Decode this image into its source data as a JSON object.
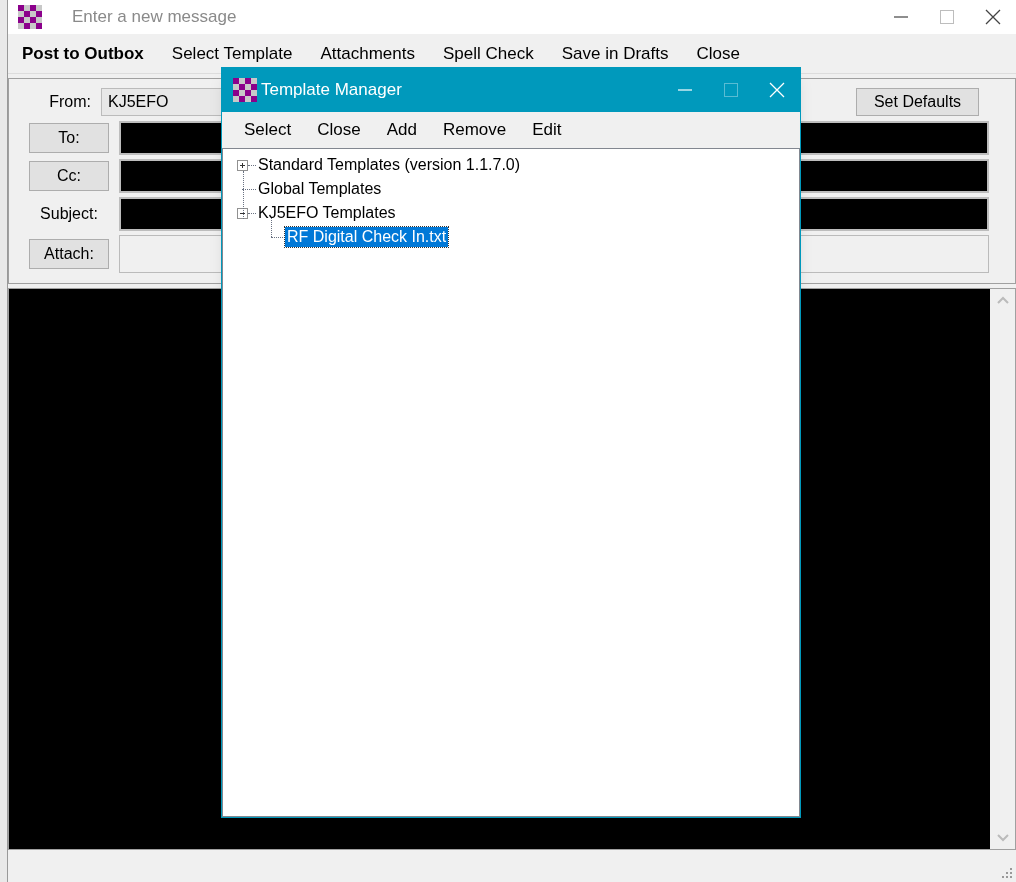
{
  "window": {
    "title": "Enter a new message"
  },
  "menu": [
    {
      "label": "Post to Outbox",
      "primary": true
    },
    {
      "label": "Select Template",
      "primary": false
    },
    {
      "label": "Attachments",
      "primary": false
    },
    {
      "label": "Spell Check",
      "primary": false
    },
    {
      "label": "Save in Drafts",
      "primary": false
    },
    {
      "label": "Close",
      "primary": false
    }
  ],
  "form": {
    "from_label": "From:",
    "from_value": "KJ5EFO",
    "set_defaults": "Set Defaults",
    "to": "To:",
    "cc": "Cc:",
    "subject": "Subject:",
    "attach": "Attach:"
  },
  "dialog": {
    "title": "Template Manager",
    "menu": [
      "Select",
      "Close",
      "Add",
      "Remove",
      "Edit"
    ],
    "tree": [
      {
        "label": "Standard Templates (version 1.1.7.0)",
        "kind": "group",
        "expanded": false,
        "selected": false
      },
      {
        "label": "Global Templates",
        "kind": "leaf",
        "selected": false
      },
      {
        "label": "KJ5EFO Templates",
        "kind": "group",
        "expanded": true,
        "selected": false,
        "children": [
          {
            "label": "RF Digital Check In.txt",
            "kind": "leaf",
            "selected": true
          }
        ]
      }
    ]
  }
}
